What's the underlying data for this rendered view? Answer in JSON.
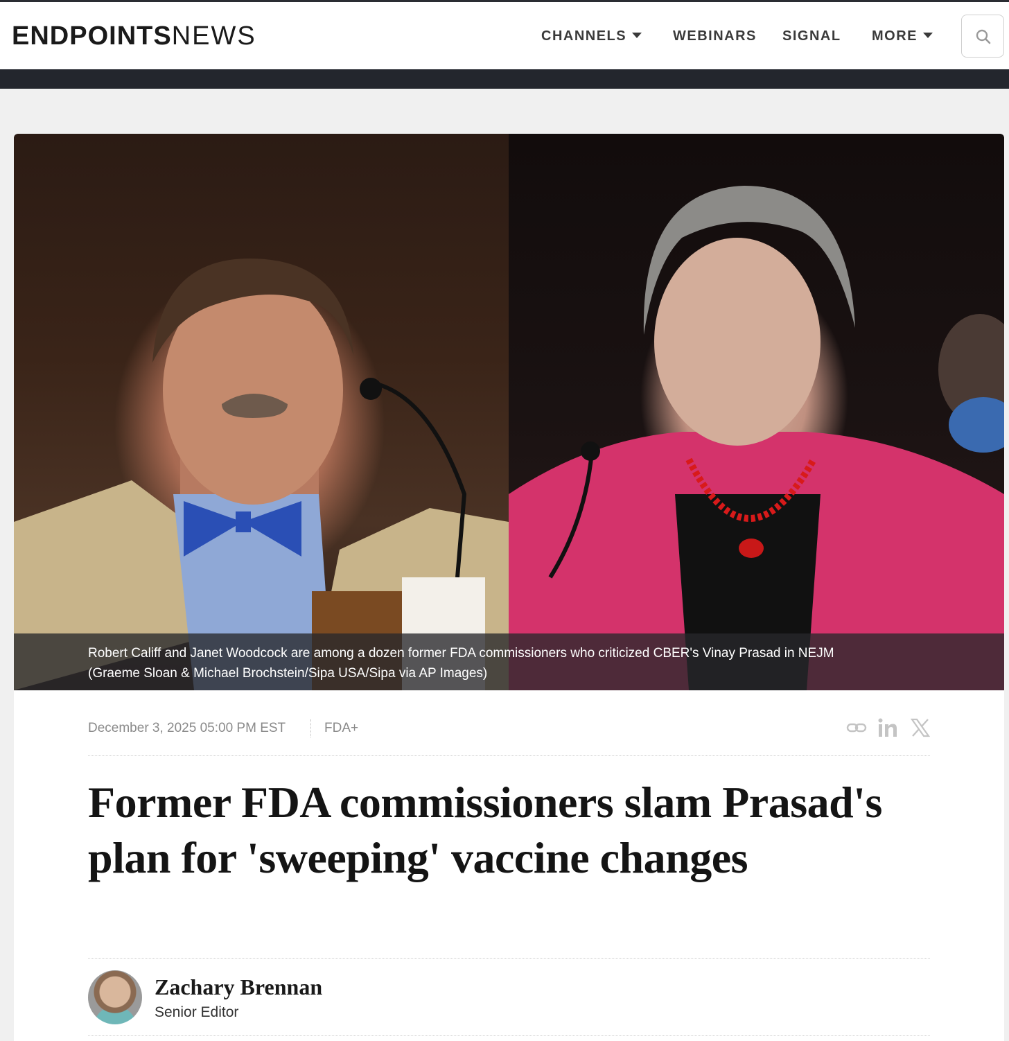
{
  "header": {
    "logo_bold": "ENDPOINTS",
    "logo_light": "NEWS",
    "nav": {
      "channels": "CHANNELS",
      "webinars": "WEBINARS",
      "signal": "SIGNAL",
      "more": "MORE"
    },
    "search_icon": "search-icon"
  },
  "article": {
    "image_caption_line1": "Robert Califf and Janet Woodcock are among a dozen former FDA commissioners who criticized CBER's Vinay Prasad in NEJM",
    "image_caption_line2": "(Graeme Sloan & Michael Brochstein/Sipa USA/Sipa via AP Images)",
    "date": "December 3, 2025 05:00 PM EST",
    "category": "FDA+",
    "share_icons": [
      "link-icon",
      "linkedin-icon",
      "x-icon"
    ],
    "headline": "Former FDA commissioners slam Prasad's plan for 'sweeping' vaccine changes",
    "author_name": "Zachary Brennan",
    "author_role": "Senior Editor"
  },
  "colors": {
    "header_bg": "#ffffff",
    "dark_bar": "#23262d",
    "page_bg": "#f0f0f0",
    "meta_text": "#8a8a8a"
  }
}
